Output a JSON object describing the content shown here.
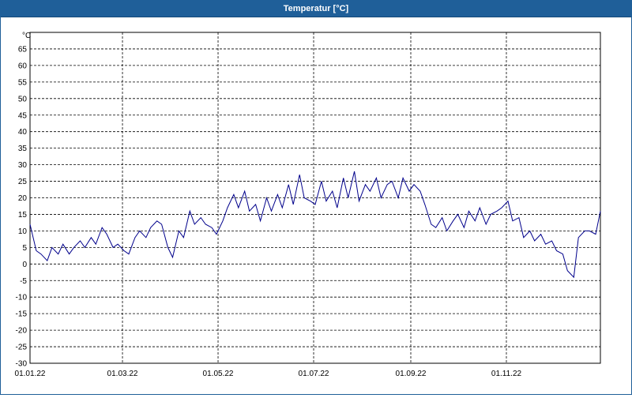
{
  "window": {
    "title": "Temperatur [°C]"
  },
  "chart_data": {
    "type": "line",
    "title": "Temperatur [°C]",
    "ylabel": "°C",
    "xlabel": "",
    "ylim": [
      -30,
      70
    ],
    "yticks": [
      65,
      60,
      55,
      50,
      45,
      40,
      35,
      30,
      25,
      20,
      15,
      10,
      5,
      0,
      -5,
      -10,
      -15,
      -20,
      -25,
      -30
    ],
    "xlim": [
      "2022-01-01",
      "2022-12-31"
    ],
    "xticks": [
      {
        "date": "2022-01-01",
        "label": "01.01.22"
      },
      {
        "date": "2022-03-01",
        "label": "01.03.22"
      },
      {
        "date": "2022-05-01",
        "label": "01.05.22"
      },
      {
        "date": "2022-07-01",
        "label": "01.07.22"
      },
      {
        "date": "2022-09-01",
        "label": "01.09.22"
      },
      {
        "date": "2022-11-01",
        "label": "01.11.22"
      }
    ],
    "grid": true,
    "line_color": "#00008b",
    "series": [
      {
        "x": [
          "2022-01-01",
          "2022-01-05",
          "2022-01-08",
          "2022-01-12",
          "2022-01-15",
          "2022-01-19",
          "2022-01-22",
          "2022-01-26",
          "2022-01-29",
          "2022-02-02",
          "2022-02-05",
          "2022-02-09",
          "2022-02-12",
          "2022-02-16",
          "2022-02-19",
          "2022-02-23",
          "2022-02-26",
          "2022-03-02",
          "2022-03-05",
          "2022-03-09",
          "2022-03-12",
          "2022-03-16",
          "2022-03-19",
          "2022-03-23",
          "2022-03-26",
          "2022-03-30",
          "2022-04-02",
          "2022-04-06",
          "2022-04-09",
          "2022-04-13",
          "2022-04-16",
          "2022-04-20",
          "2022-04-23",
          "2022-04-27",
          "2022-04-30",
          "2022-05-04",
          "2022-05-07",
          "2022-05-11",
          "2022-05-14",
          "2022-05-18",
          "2022-05-21",
          "2022-05-25",
          "2022-05-28",
          "2022-06-01",
          "2022-06-04",
          "2022-06-08",
          "2022-06-11",
          "2022-06-15",
          "2022-06-18",
          "2022-06-22",
          "2022-06-25",
          "2022-06-29",
          "2022-07-02",
          "2022-07-06",
          "2022-07-09",
          "2022-07-13",
          "2022-07-16",
          "2022-07-20",
          "2022-07-23",
          "2022-07-27",
          "2022-07-30",
          "2022-08-03",
          "2022-08-06",
          "2022-08-10",
          "2022-08-13",
          "2022-08-17",
          "2022-08-20",
          "2022-08-24",
          "2022-08-27",
          "2022-08-31",
          "2022-09-03",
          "2022-09-07",
          "2022-09-10",
          "2022-09-14",
          "2022-09-17",
          "2022-09-21",
          "2022-09-24",
          "2022-09-28",
          "2022-10-01",
          "2022-10-05",
          "2022-10-08",
          "2022-10-12",
          "2022-10-15",
          "2022-10-19",
          "2022-10-22",
          "2022-10-26",
          "2022-10-29",
          "2022-11-02",
          "2022-11-05",
          "2022-11-09",
          "2022-11-12",
          "2022-11-16",
          "2022-11-19",
          "2022-11-23",
          "2022-11-26",
          "2022-11-30",
          "2022-12-03",
          "2022-12-07",
          "2022-12-10",
          "2022-12-14",
          "2022-12-17",
          "2022-12-21",
          "2022-12-24",
          "2022-12-28",
          "2022-12-31"
        ],
        "y": [
          12,
          4,
          3,
          1,
          5,
          3,
          6,
          3,
          5,
          7,
          5,
          8,
          6,
          11,
          9,
          5,
          6,
          4,
          3,
          8,
          10,
          8,
          11,
          13,
          12,
          5,
          2,
          10,
          8,
          16,
          12,
          14,
          12,
          11,
          9,
          13,
          17,
          21,
          17,
          22,
          16,
          18,
          13,
          20,
          16,
          21,
          17,
          24,
          18,
          27,
          20,
          19,
          18,
          25,
          19,
          22,
          17,
          26,
          20,
          28,
          19,
          24,
          22,
          26,
          20,
          24,
          25,
          20,
          26,
          22,
          24,
          22,
          18,
          12,
          11,
          14,
          10,
          13,
          15,
          11,
          16,
          13,
          17,
          12,
          15,
          16,
          17,
          19,
          13,
          14,
          8,
          10,
          7,
          9,
          6,
          7,
          4,
          3,
          -2,
          -4,
          8,
          10,
          10,
          9,
          16
        ]
      }
    ]
  }
}
